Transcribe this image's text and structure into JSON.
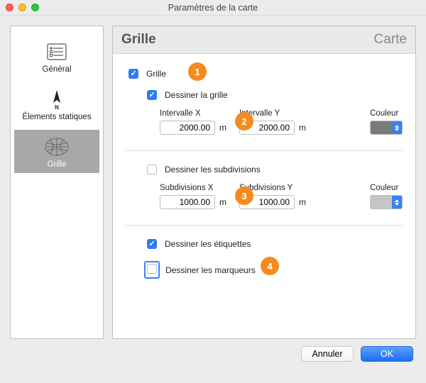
{
  "window": {
    "title": "Paramètres de la carte"
  },
  "sidebar": {
    "items": [
      {
        "id": "general",
        "label": "Général"
      },
      {
        "id": "static",
        "label": "Élements statiques"
      },
      {
        "id": "grid",
        "label": "Grille"
      }
    ],
    "selected": "grid"
  },
  "header": {
    "left": "Grille",
    "right": "Carte"
  },
  "options": {
    "grid_label": "Grille",
    "grid_checked": true,
    "draw_grid_label": "Dessiner la grille",
    "draw_grid_checked": true,
    "interval_x_label": "Intervalle X",
    "interval_x_value": "2000.00",
    "interval_y_label": "Intervalle Y",
    "interval_y_value": "2000.00",
    "unit": "m",
    "color_label": "Couleur",
    "grid_color": "#7a7a7a",
    "draw_subdiv_label": "Dessiner les subdivisions",
    "draw_subdiv_checked": false,
    "subdiv_x_label": "Subdivisions X",
    "subdiv_x_value": "1000.00",
    "subdiv_y_label": "Subdivisions Y",
    "subdiv_y_value": "1000.00",
    "subdiv_color": "#c6c6c6",
    "draw_labels_label": "Dessiner les étiquettes",
    "draw_labels_checked": true,
    "draw_markers_label": "Dessiner les marqueurs",
    "draw_markers_checked": false
  },
  "callouts": {
    "c1": "1",
    "c2": "2",
    "c3": "3",
    "c4": "4"
  },
  "footer": {
    "cancel": "Annuler",
    "ok": "OK"
  }
}
